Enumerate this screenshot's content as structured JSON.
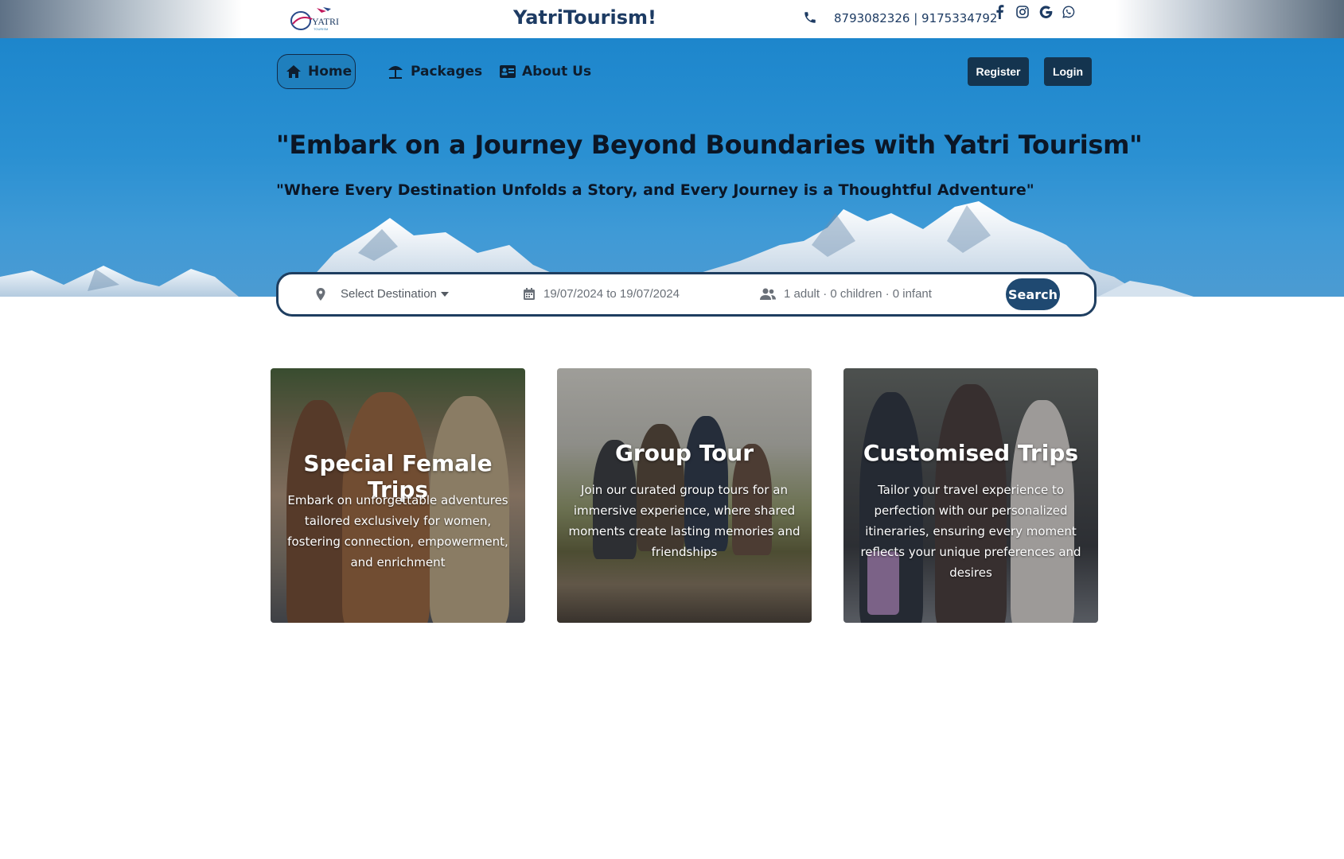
{
  "header": {
    "brand": "YatriTourism!",
    "phones": "8793082326 | 9175334792",
    "logo_text": "YATRI"
  },
  "nav": {
    "home": "Home",
    "packages": "Packages",
    "about": "About Us",
    "register": "Register",
    "login": "Login"
  },
  "hero": {
    "title": "\"Embark on a Journey Beyond Boundaries with Yatri Tourism\"",
    "subtitle": "\"Where Every Destination Unfolds a Story, and Every Journey is a Thoughtful Adventure\""
  },
  "search": {
    "destination": "Select Destination",
    "dates": "19/07/2024 to 19/07/2024",
    "guests": "1 adult · 0 children · 0 infant",
    "button": "Search"
  },
  "cards": [
    {
      "title": "Special Female Trips",
      "desc": "Embark on unforgettable adventures tailored exclusively for women, fostering connection, empowerment, and enrichment"
    },
    {
      "title": "Group Tour",
      "desc": "Join our curated group tours for an immersive experience, where shared moments create lasting memories and friendships"
    },
    {
      "title": "Customised Trips",
      "desc": "Tailor your travel experience to perfection with our personalized itineraries, ensuring every moment reflects your unique preferences and desires"
    }
  ],
  "colors": {
    "brand_dark": "#1d3b63",
    "hero_blue": "#2a90d2",
    "button_dark": "#14344f",
    "search_button": "#1f4971"
  }
}
